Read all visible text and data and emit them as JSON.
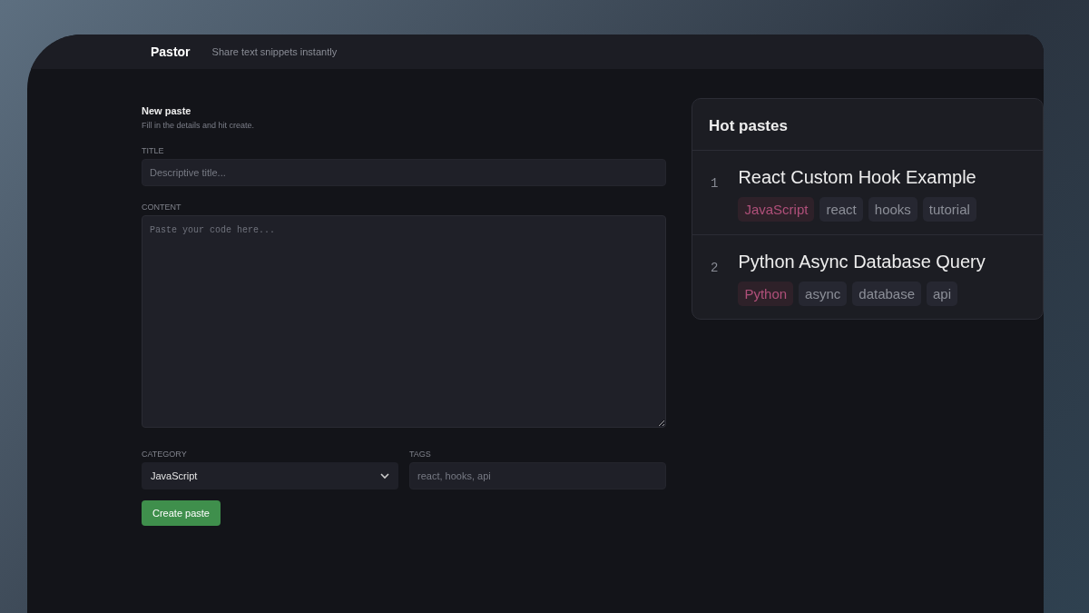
{
  "header": {
    "brand": "Pastor",
    "tagline": "Share text snippets instantly"
  },
  "form": {
    "title": "New paste",
    "subtitle": "Fill in the details and hit create.",
    "fields": [
      {
        "label": "TITLE",
        "placeholder": "Descriptive title..."
      },
      {
        "label": "CONTENT",
        "placeholder": "Paste your code here..."
      }
    ],
    "category": {
      "label": "CATEGORY",
      "value": "JavaScript"
    },
    "tags": {
      "label": "TAGS",
      "placeholder": "react, hooks, api"
    },
    "submit": "Create paste"
  },
  "hot": {
    "title": "Hot pastes",
    "items": [
      {
        "rank": "1",
        "title": "React Custom Hook Example",
        "tags": [
          {
            "label": "JavaScript",
            "kind": "category"
          },
          {
            "label": "react",
            "kind": "tag"
          },
          {
            "label": "hooks",
            "kind": "tag"
          },
          {
            "label": "tutorial",
            "kind": "tag"
          }
        ]
      },
      {
        "rank": "2",
        "title": "Python Async Database Query",
        "tags": [
          {
            "label": "Python",
            "kind": "category"
          },
          {
            "label": "async",
            "kind": "tag"
          },
          {
            "label": "database",
            "kind": "tag"
          },
          {
            "label": "api",
            "kind": "tag"
          }
        ]
      }
    ]
  }
}
